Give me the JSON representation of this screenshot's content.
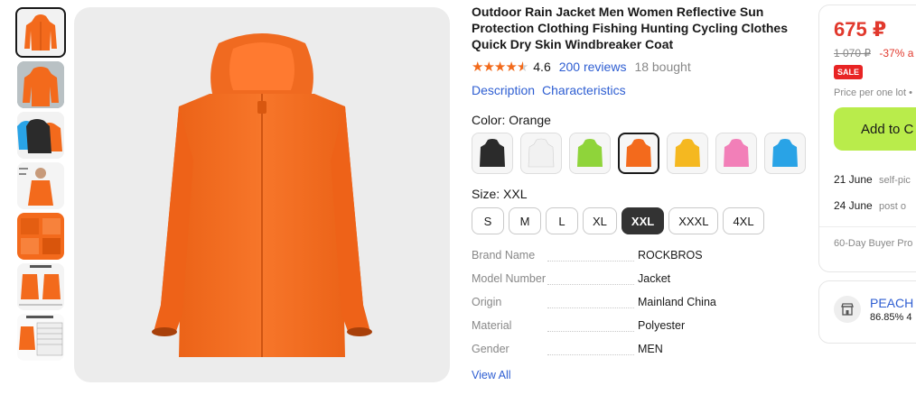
{
  "product": {
    "title": "Outdoor Rain Jacket Men Women Reflective Sun Protection Clothing Fishing Hunting Cycling Clothes Quick Dry Skin Windbreaker Coat",
    "rating": "4.6",
    "rating_stars": 4.6,
    "reviews": "200 reviews",
    "bought": "18 bought",
    "links": [
      "Description",
      "Characteristics"
    ]
  },
  "color": {
    "label": "Color: Orange",
    "options": [
      {
        "name": "black",
        "hex": "#2b2b2b"
      },
      {
        "name": "white",
        "hex": "#f1f1f1"
      },
      {
        "name": "green",
        "hex": "#8fd43a"
      },
      {
        "name": "orange",
        "hex": "#f36a1c"
      },
      {
        "name": "yellow",
        "hex": "#f5b820"
      },
      {
        "name": "pink",
        "hex": "#f27fb8"
      },
      {
        "name": "blue",
        "hex": "#29a3e6"
      }
    ],
    "selected_index": 3
  },
  "size": {
    "label": "Size: XXL",
    "options": [
      "S",
      "M",
      "L",
      "XL",
      "XXL",
      "XXXL",
      "4XL"
    ],
    "selected": "XXL"
  },
  "specs": [
    {
      "key": "Brand Name",
      "value": "ROCKBROS"
    },
    {
      "key": "Model Number",
      "value": "Jacket"
    },
    {
      "key": "Origin",
      "value": "Mainland China"
    },
    {
      "key": "Material",
      "value": "Polyester"
    },
    {
      "key": "Gender",
      "value": "MEN"
    }
  ],
  "view_all": "View All",
  "buy_box": {
    "price": "675 ₽",
    "old_price": "1 070 ₽",
    "discount": "-37% a",
    "badge": "SALE",
    "per_lot": "Price per one lot •",
    "add_button": "Add to C",
    "delivery": [
      {
        "date": "21 June",
        "note": "self-pic"
      },
      {
        "date": "24 June",
        "note": "post o"
      }
    ],
    "protection": "60-Day Buyer Pro"
  },
  "store": {
    "name": "PEACH",
    "stat": "86.85%",
    "stat_tail": "4"
  },
  "colors": {
    "accent_blue": "#2e5ed2",
    "price_red": "#e1392d",
    "star_orange": "#f26a1b",
    "add_button_green": "#b9ec4b",
    "jacket_orange": "#f36a1c"
  },
  "thumbnails": [
    "orange-jacket-thumb",
    "orange-jacket-lifestyle-thumb",
    "three-color-jackets-thumb",
    "model-wearing-jacket-thumb",
    "jacket-detail-thumb",
    "size-chart-thumb",
    "size-table-thumb"
  ]
}
